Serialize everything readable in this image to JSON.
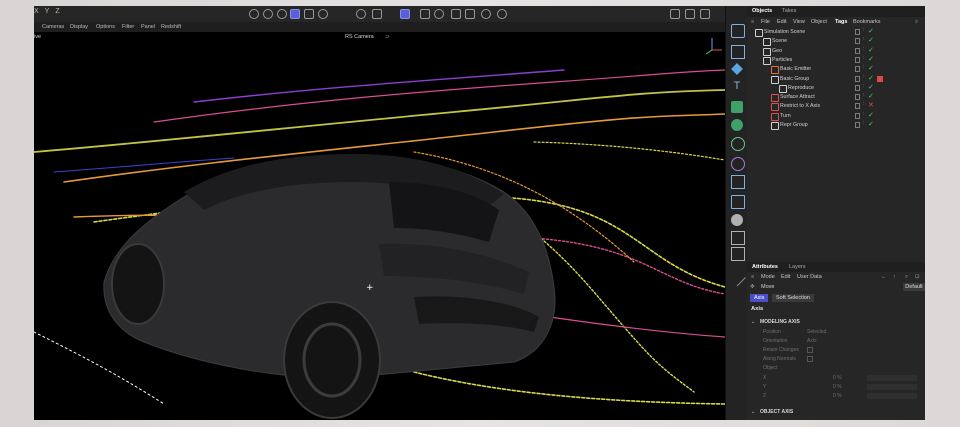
{
  "toolbar": {
    "axis_labels": [
      "X",
      "Y",
      "Z"
    ]
  },
  "menubar": {
    "items": [
      "Cameras",
      "Display",
      "Options",
      "Filter",
      "Panel",
      "Redshift"
    ]
  },
  "viewport": {
    "view_label": "ive",
    "camera_label": "RS Camera"
  },
  "objects_panel": {
    "tabs": [
      "Objects",
      "Takes"
    ],
    "menu": [
      "File",
      "Edit",
      "View",
      "Object",
      "Tags",
      "Bookmarks"
    ],
    "rows": [
      {
        "label": "Simulation Scene",
        "icon": "simulation-scene-icon",
        "color": "#d0d0d0",
        "tag": "check"
      },
      {
        "label": "Scene",
        "icon": "null-icon",
        "color": "#d0d0d0",
        "tag": "check"
      },
      {
        "label": "Geo",
        "icon": "null-icon",
        "color": "#d0d0d0",
        "tag": "check"
      },
      {
        "label": "Particles",
        "icon": "null-icon",
        "color": "#d0d0d0",
        "tag": "check"
      },
      {
        "label": "Basic Emitter",
        "icon": "emitter-icon",
        "color": "#e07040",
        "tag": "check"
      },
      {
        "label": "Basic Group",
        "icon": "group-icon",
        "color": "#d0d0d0",
        "tag": "check",
        "extra_tag": "red-cube-icon"
      },
      {
        "label": "Reproduce",
        "icon": "reproduce-icon",
        "color": "#d0d0d0",
        "tag": "check"
      },
      {
        "label": "Surface Attract",
        "icon": "surface-attract-icon",
        "color": "#e05050",
        "tag": "check"
      },
      {
        "label": "Restrict to X Axis",
        "icon": "restrict-icon",
        "color": "#e05050",
        "tag": "cross"
      },
      {
        "label": "Turn",
        "icon": "turn-icon",
        "color": "#e05050",
        "tag": "check"
      },
      {
        "label": "Repr Group",
        "icon": "group-icon",
        "color": "#d0d0d0",
        "tag": "check"
      }
    ]
  },
  "attributes_panel": {
    "tabs": [
      "Attributes",
      "Layers"
    ],
    "menu": [
      "Mode",
      "Edit",
      "User Data"
    ],
    "object_name": "Move",
    "default_button": "Default",
    "sub_tabs": [
      "Axis",
      "Soft Selection"
    ],
    "section_title": "Axis",
    "modeling_axis": {
      "title": "MODELING AXIS",
      "props": [
        {
          "label": "Position",
          "value": "Selected"
        },
        {
          "label": "Orientation",
          "value": "Axis"
        },
        {
          "label": "Retain Changes",
          "value": ""
        },
        {
          "label": "Along Normals",
          "value": ""
        },
        {
          "label": "Object",
          "value": ""
        }
      ],
      "coords": [
        {
          "label": "X",
          "value": "0 %"
        },
        {
          "label": "Y",
          "value": "0 %"
        },
        {
          "label": "Z",
          "value": "0 %"
        }
      ]
    },
    "object_axis_title": "OBJECT AXIS"
  },
  "colors": {
    "accent": "#5b5fd6",
    "check": "#4fd06a",
    "cross": "#e04848",
    "streak_yellow": "#d8d84a",
    "streak_orange": "#e59a3a",
    "streak_pink": "#d64f8e",
    "streak_purple": "#8a3fd0"
  }
}
